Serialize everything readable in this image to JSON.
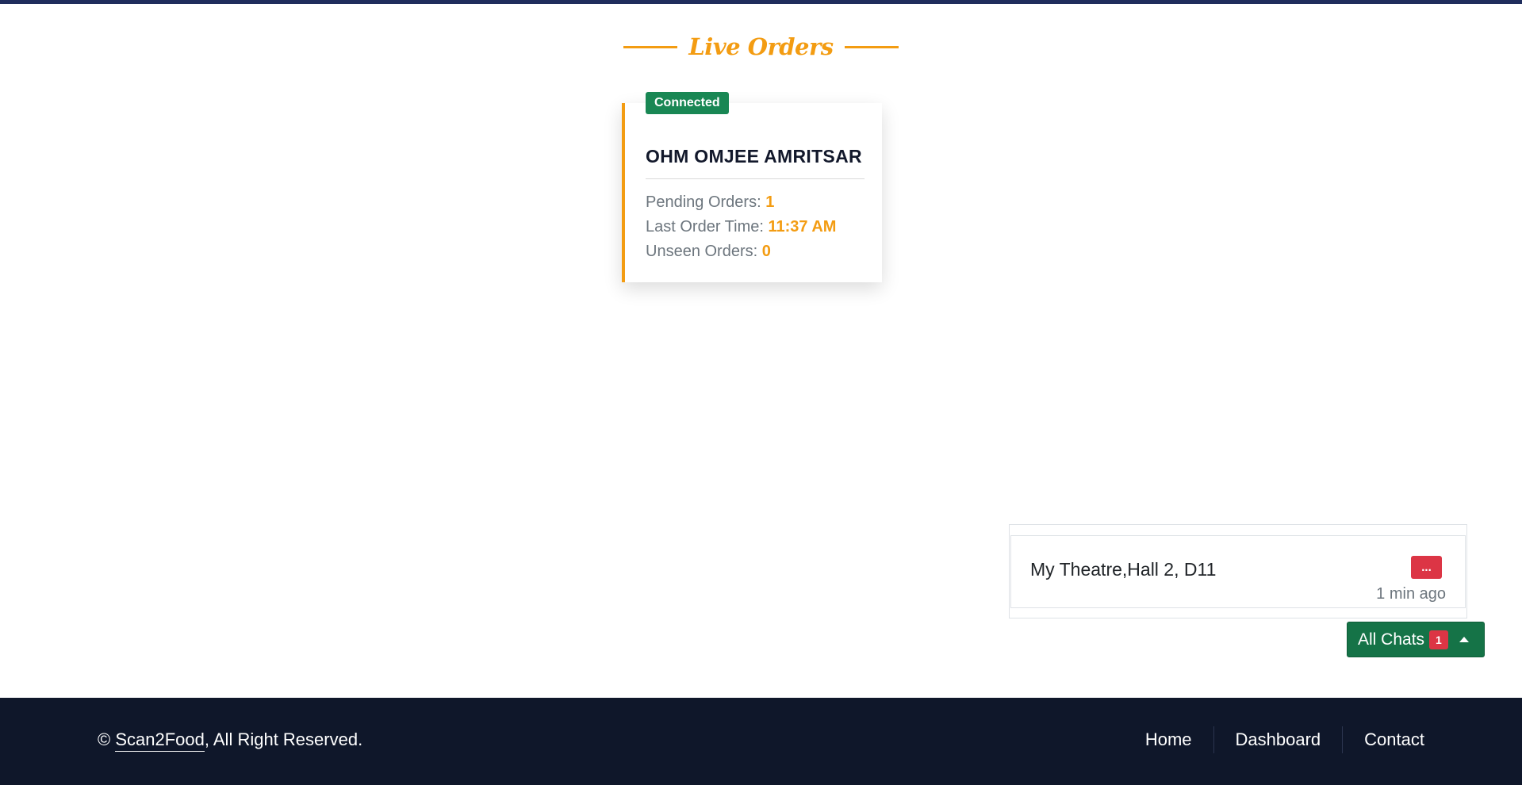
{
  "page": {
    "heading": "Live Orders"
  },
  "restaurant": {
    "status": "Connected",
    "name": "OHM OMJEE AMRITSAR",
    "stats": [
      {
        "label": "Pending Orders:",
        "value": "1"
      },
      {
        "label": "Last Order Time:",
        "value": "11:37 AM"
      },
      {
        "label": "Unseen Orders:",
        "value": "0"
      }
    ]
  },
  "chats": {
    "items": [
      {
        "title": "My Theatre,Hall 2, D11",
        "menu_label": "...",
        "time": "1 min ago"
      }
    ],
    "toggle_label": "All Chats",
    "unread_count": "1"
  },
  "footer": {
    "copyright_symbol": "©",
    "brand": "Scan2Food",
    "rights": ", All Right Reserved.",
    "links": [
      "Home",
      "Dashboard",
      "Contact"
    ]
  },
  "colors": {
    "accent": "#f39c12",
    "success": "#198754",
    "danger": "#dc3545",
    "footer_bg": "#0f172a",
    "top_bar": "#1f2d5c"
  },
  "icons": {
    "chat_toggle": "caret-up-icon"
  }
}
